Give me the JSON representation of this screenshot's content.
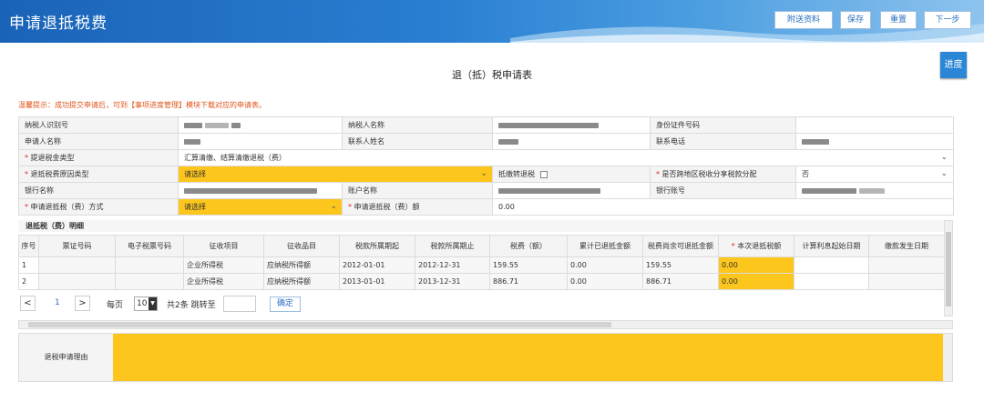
{
  "header": {
    "title": "申请退抵税费",
    "buttons": [
      "附送资料",
      "保存",
      "重置",
      "下一步"
    ]
  },
  "form": {
    "title": "退（抵）税申请表",
    "progress_label": "进度",
    "tip": "温馨提示：成功提交申请后，可到【事项进度管理】模块下载对应的申请表。",
    "labels": {
      "taxpayer_id": "纳税人识别号",
      "taxpayer_name": "纳税人名称",
      "id_number": "身份证件号码",
      "applicant_name": "申请人名称",
      "contact_name": "联系人姓名",
      "contact_phone": "联系电话",
      "tax_refund_type": "提退税金类型",
      "refund_reason_type": "退抵税费原因类型",
      "deduct_refund": "抵缴转退税",
      "cross_region": "是否跨地区税收分享税款分配",
      "bank_name": "银行名称",
      "account_name": "账户名称",
      "bank_account": "银行账号",
      "refund_method": "申请退抵税（费）方式",
      "refund_amount": "申请退抵税（费）额"
    },
    "values": {
      "tax_refund_type": "汇算清缴、结算清缴退税（费）",
      "refund_reason_type": "请选择",
      "cross_region": "否",
      "refund_method": "请选择",
      "refund_amount": "0.00"
    }
  },
  "detail": {
    "title": "退抵税（费）明细",
    "columns": [
      "序号",
      "票证号码",
      "电子税票号码",
      "征收项目",
      "征收品目",
      "税款所属期起",
      "税款所属期止",
      "税费（额）",
      "累计已退抵金额",
      "税费尚余可退抵金额",
      "本次退抵税额",
      "计算利息起始日期",
      "缴款发生日期"
    ],
    "rows": [
      [
        "1",
        "",
        "",
        "企业所得税",
        "应纳税所得额",
        "2012-01-01",
        "2012-12-31",
        "159.55",
        "0.00",
        "159.55",
        "0.00",
        "",
        ""
      ],
      [
        "2",
        "",
        "",
        "企业所得税",
        "应纳税所得额",
        "2013-01-01",
        "2013-12-31",
        "886.71",
        "0.00",
        "886.71",
        "0.00",
        "",
        ""
      ]
    ]
  },
  "pager": {
    "current_page": "1",
    "per_page_label": "每页",
    "per_page_value": "10",
    "summary": "共2条 跳转至",
    "confirm": "确定",
    "prev": "<",
    "next": ">"
  },
  "reason": {
    "label": "退税申请理由"
  },
  "colors": {
    "accent": "#2b86d6",
    "highlight": "#fdc61c",
    "tip": "#e0541a"
  }
}
